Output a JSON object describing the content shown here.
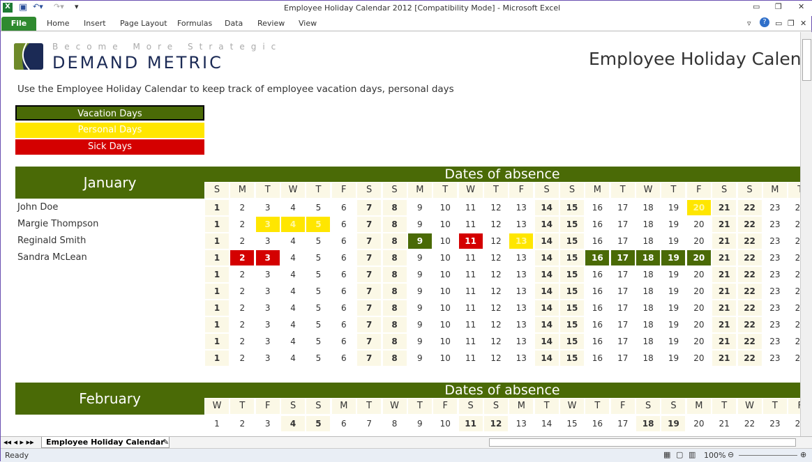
{
  "window": {
    "title": "Employee Holiday Calendar 2012  [Compatibility Mode]  -  Microsoft Excel"
  },
  "ribbon": {
    "tabs": [
      "File",
      "Home",
      "Insert",
      "Page Layout",
      "Formulas",
      "Data",
      "Review",
      "View"
    ]
  },
  "logo": {
    "tagline": "Become More Strategic",
    "name": "DEMAND METRIC"
  },
  "sheet": {
    "title": "Employee Holiday Calenda",
    "instructions": "Use the Employee Holiday Calendar to keep track of employee vacation days, personal days",
    "legend": [
      {
        "label": "Vacation Days",
        "color": "#4a6a06"
      },
      {
        "label": "Personal Days",
        "color": "#ffe600"
      },
      {
        "label": "Sick Days",
        "color": "#d40000"
      }
    ],
    "employees": [
      "John Doe",
      "Margie Thompson",
      "Reginald Smith",
      "Sandra McLean"
    ],
    "months": [
      {
        "name": "January",
        "band": "Dates of absence",
        "letters": [
          "S",
          "M",
          "T",
          "W",
          "T",
          "F",
          "S",
          "S",
          "M",
          "T",
          "W",
          "T",
          "F",
          "S",
          "S",
          "M",
          "T",
          "W",
          "T",
          "F",
          "S",
          "S",
          "M",
          "T"
        ],
        "weekend_days": [
          1,
          7,
          8,
          14,
          15,
          21,
          22
        ],
        "rows": 10,
        "absences": [
          {
            "row": 0,
            "days": [
              20
            ],
            "type": "personal"
          },
          {
            "row": 1,
            "days": [
              3,
              4,
              5
            ],
            "type": "personal"
          },
          {
            "row": 2,
            "days": [
              9
            ],
            "type": "vacation"
          },
          {
            "row": 2,
            "days": [
              11
            ],
            "type": "sick"
          },
          {
            "row": 2,
            "days": [
              13
            ],
            "type": "personal"
          },
          {
            "row": 3,
            "days": [
              2,
              3
            ],
            "type": "sick"
          },
          {
            "row": 3,
            "days": [
              16,
              17,
              18,
              19,
              20
            ],
            "type": "vacation"
          }
        ]
      },
      {
        "name": "February",
        "band": "Dates of absence",
        "letters": [
          "W",
          "T",
          "F",
          "S",
          "S",
          "M",
          "T",
          "W",
          "T",
          "F",
          "S",
          "S",
          "M",
          "T",
          "W",
          "T",
          "F",
          "S",
          "S",
          "M",
          "T",
          "W",
          "T",
          "F"
        ],
        "weekend_days": [
          4,
          5,
          11,
          12,
          18,
          19
        ],
        "rows": 1,
        "absences": []
      }
    ]
  },
  "sheet_tab": "Employee Holiday Calendar",
  "status": {
    "ready": "Ready",
    "zoom": "100%"
  },
  "colors": {
    "vacation": "#4a6a06",
    "personal": "#ffe600",
    "sick": "#d40000"
  }
}
